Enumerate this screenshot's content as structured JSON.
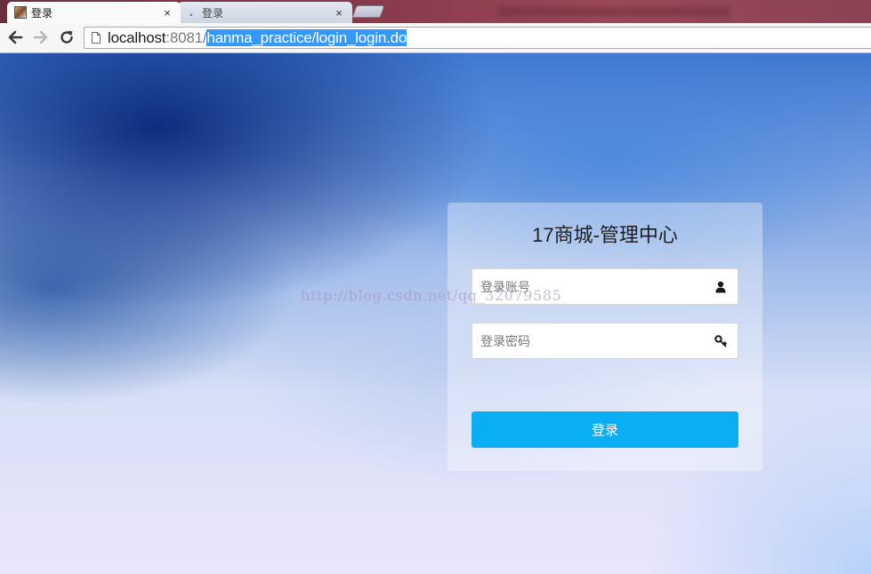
{
  "browser": {
    "tabs": [
      {
        "title": "登录",
        "close": "×",
        "active": true
      },
      {
        "title": "登录",
        "close": "×",
        "active": false
      }
    ],
    "url": {
      "host": "localhost",
      "port": ":8081/",
      "path": "hanma_practice/login_login.do"
    },
    "icons": {
      "back": "arrow-left-icon",
      "forward": "arrow-right-icon",
      "reload": "reload-icon",
      "page": "page-icon"
    }
  },
  "watermark": "http://blog.csdn.net/qq_32079585",
  "login": {
    "title": "17商城-管理中心",
    "account_placeholder": "登录账号",
    "password_placeholder": "登录密码",
    "button_label": "登录",
    "icons": {
      "account": "user-icon",
      "password": "key-icon"
    }
  },
  "colors": {
    "button": "#0aaef2",
    "url_selection": "#3399ff",
    "tabstrip": "#8a3b4c"
  }
}
